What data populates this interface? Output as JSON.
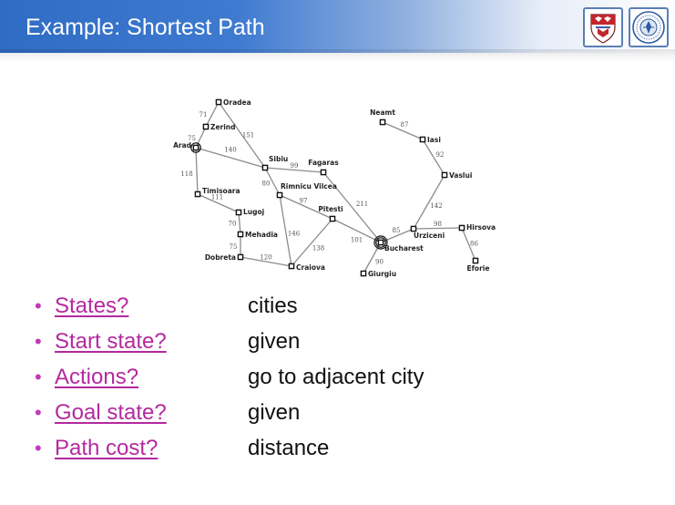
{
  "slide": {
    "title": "Example: Shortest Path"
  },
  "logos": [
    {
      "name": "crest-shield-logo",
      "colors": [
        "#c0272d",
        "#ffffff",
        "#3b5ea8"
      ]
    },
    {
      "name": "round-seal-logo",
      "colors": [
        "#2d5aa0",
        "#ffffff"
      ]
    }
  ],
  "colors": {
    "title_bar": "#2f6cc3",
    "question_link": "#b4299f",
    "answer_text": "#111111",
    "map_edge": "#8c8c8c"
  },
  "map": {
    "cities": [
      {
        "id": "oradea",
        "name": "Oradea",
        "p": [
          60,
          16
        ],
        "anchor": "start",
        "l": [
          5,
          3
        ],
        "ring": 0
      },
      {
        "id": "zerind",
        "name": "Zerind",
        "p": [
          46,
          43
        ],
        "anchor": "start",
        "l": [
          5,
          3
        ],
        "ring": 0
      },
      {
        "id": "arad",
        "name": "Arad",
        "p": [
          35,
          66
        ],
        "anchor": "end",
        "l": [
          -5,
          0
        ],
        "ring": 1
      },
      {
        "id": "timisoara",
        "name": "Timisoara",
        "p": [
          37,
          117
        ],
        "anchor": "start",
        "l": [
          5,
          -1
        ],
        "ring": 0
      },
      {
        "id": "lugoj",
        "name": "Lugoj",
        "p": [
          82,
          137
        ],
        "anchor": "start",
        "l": [
          5,
          2
        ],
        "ring": 0
      },
      {
        "id": "mehadia",
        "name": "Mehadia",
        "p": [
          84,
          161
        ],
        "anchor": "start",
        "l": [
          5,
          3
        ],
        "ring": 0
      },
      {
        "id": "dobreta",
        "name": "Dobreta",
        "p": [
          84,
          186
        ],
        "anchor": "end",
        "l": [
          -5,
          3
        ],
        "ring": 0
      },
      {
        "id": "craiova",
        "name": "Craiova",
        "p": [
          140,
          196
        ],
        "anchor": "start",
        "l": [
          5,
          4
        ],
        "ring": 0
      },
      {
        "id": "sibiu",
        "name": "Sibiu",
        "p": [
          111,
          88
        ],
        "anchor": "start",
        "l": [
          4,
          -7
        ],
        "ring": 0
      },
      {
        "id": "fagaras",
        "name": "Fagaras",
        "p": [
          175,
          93
        ],
        "anchor": "middle",
        "l": [
          0,
          -8
        ],
        "ring": 0
      },
      {
        "id": "rimnicu",
        "name": "Rimnicu Vilcea",
        "p": [
          127,
          118
        ],
        "anchor": "start",
        "l": [
          1,
          -7
        ],
        "ring": 0
      },
      {
        "id": "pitesti",
        "name": "Pitesti",
        "p": [
          185,
          144
        ],
        "anchor": "middle",
        "l": [
          -2,
          -8
        ],
        "ring": 0
      },
      {
        "id": "bucharest",
        "name": "Bucharest",
        "p": [
          238,
          170
        ],
        "anchor": "start",
        "l": [
          4,
          9
        ],
        "ring": 2
      },
      {
        "id": "giurgiu",
        "name": "Giurgiu",
        "p": [
          219,
          204
        ],
        "anchor": "start",
        "l": [
          5,
          3
        ],
        "ring": 0
      },
      {
        "id": "urziceni",
        "name": "Urziceni",
        "p": [
          274,
          155
        ],
        "anchor": "start",
        "l": [
          0,
          10
        ],
        "ring": 0
      },
      {
        "id": "hirsova",
        "name": "Hirsova",
        "p": [
          327,
          154
        ],
        "anchor": "start",
        "l": [
          5,
          2
        ],
        "ring": 0
      },
      {
        "id": "eforie",
        "name": "Eforie",
        "p": [
          342,
          190
        ],
        "anchor": "middle",
        "l": [
          3,
          11
        ],
        "ring": 0
      },
      {
        "id": "vaslui",
        "name": "Vaslui",
        "p": [
          308,
          96
        ],
        "anchor": "start",
        "l": [
          5,
          3
        ],
        "ring": 0
      },
      {
        "id": "iasi",
        "name": "Iasi",
        "p": [
          284,
          57
        ],
        "anchor": "start",
        "l": [
          5,
          3
        ],
        "ring": 0
      },
      {
        "id": "neamt",
        "name": "Neamt",
        "p": [
          240,
          38
        ],
        "anchor": "middle",
        "l": [
          0,
          -8
        ],
        "ring": 0
      }
    ],
    "roads": [
      {
        "a": "oradea",
        "b": "zerind",
        "d": "71",
        "o": [
          -10,
          0
        ]
      },
      {
        "a": "zerind",
        "b": "arad",
        "d": "75",
        "o": [
          -10,
          1
        ]
      },
      {
        "a": "oradea",
        "b": "sibiu",
        "d": "151",
        "o": [
          7,
          0
        ]
      },
      {
        "a": "arad",
        "b": "sibiu",
        "d": "140",
        "o": [
          0,
          -9
        ]
      },
      {
        "a": "arad",
        "b": "timisoara",
        "d": "118",
        "o": [
          -11,
          3
        ]
      },
      {
        "a": "timisoara",
        "b": "lugoj",
        "d": "111",
        "o": [
          -1,
          -7
        ]
      },
      {
        "a": "lugoj",
        "b": "mehadia",
        "d": "70",
        "o": [
          -8,
          0
        ]
      },
      {
        "a": "mehadia",
        "b": "dobreta",
        "d": "75",
        "o": [
          -8,
          1
        ]
      },
      {
        "a": "dobreta",
        "b": "craiova",
        "d": "120",
        "o": [
          0,
          -5
        ]
      },
      {
        "a": "sibiu",
        "b": "fagaras",
        "d": "99",
        "o": [
          0,
          -5
        ]
      },
      {
        "a": "sibiu",
        "b": "rimnicu",
        "d": "80",
        "o": [
          -7,
          2
        ]
      },
      {
        "a": "rimnicu",
        "b": "pitesti",
        "d": "97",
        "o": [
          -3,
          -7
        ]
      },
      {
        "a": "rimnicu",
        "b": "craiova",
        "d": "146",
        "o": [
          9,
          3
        ]
      },
      {
        "a": "craiova",
        "b": "pitesti",
        "d": "138",
        "o": [
          7,
          6
        ]
      },
      {
        "a": "pitesti",
        "b": "bucharest",
        "d": "101",
        "o": [
          0,
          10
        ]
      },
      {
        "a": "fagaras",
        "b": "bucharest",
        "d": "211",
        "o": [
          11,
          -4
        ]
      },
      {
        "a": "bucharest",
        "b": "giurgiu",
        "d": "90",
        "o": [
          8,
          4
        ]
      },
      {
        "a": "bucharest",
        "b": "urziceni",
        "d": "85",
        "o": [
          -1,
          -6
        ]
      },
      {
        "a": "urziceni",
        "b": "hirsova",
        "d": "98",
        "o": [
          0,
          -5
        ]
      },
      {
        "a": "hirsova",
        "b": "eforie",
        "d": "86",
        "o": [
          6,
          -1
        ]
      },
      {
        "a": "urziceni",
        "b": "vaslui",
        "d": "142",
        "o": [
          8,
          4
        ]
      },
      {
        "a": "vaslui",
        "b": "iasi",
        "d": "92",
        "o": [
          7,
          -3
        ]
      },
      {
        "a": "iasi",
        "b": "neamt",
        "d": "87",
        "o": [
          2,
          -7
        ]
      }
    ]
  },
  "qa": [
    {
      "question": "States?",
      "answer": "cities"
    },
    {
      "question": "Start state?",
      "answer": "given"
    },
    {
      "question": "Actions?",
      "answer": "go to adjacent city"
    },
    {
      "question": "Goal state?",
      "answer": "given"
    },
    {
      "question": "Path cost?",
      "answer": "distance"
    }
  ]
}
